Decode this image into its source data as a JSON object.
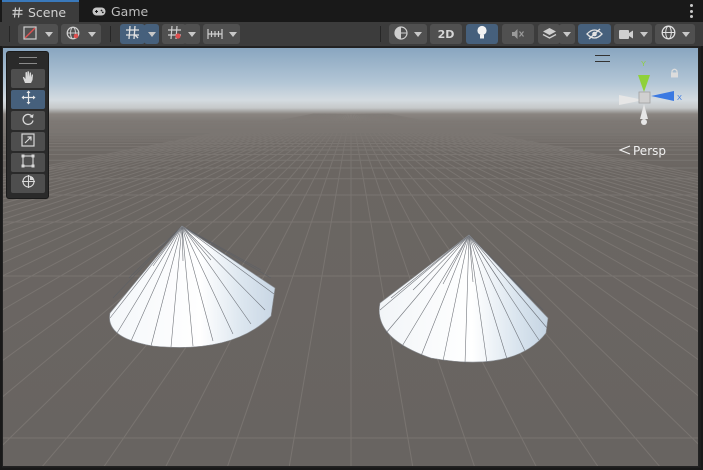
{
  "tabs": [
    {
      "label": "Scene",
      "icon": "hash-icon",
      "active": true
    },
    {
      "label": "Game",
      "icon": "gamepad-icon",
      "active": false
    }
  ],
  "toolbar": {
    "toggle_2d_label": "2D"
  },
  "tools": [
    {
      "name": "hand-tool",
      "icon": "hand-icon",
      "selected": false
    },
    {
      "name": "move-tool",
      "icon": "move-icon",
      "selected": true
    },
    {
      "name": "rotate-tool",
      "icon": "rotate-icon",
      "selected": false
    },
    {
      "name": "scale-tool",
      "icon": "scale-icon",
      "selected": false
    },
    {
      "name": "rect-tool",
      "icon": "rect-icon",
      "selected": false
    },
    {
      "name": "transform-tool",
      "icon": "transform-icon",
      "selected": false
    }
  ],
  "gizmo": {
    "y_label": "Y",
    "x_label": "X",
    "projection_label": "Persp"
  },
  "colors": {
    "accent": "#46607c",
    "tab_highlight": "#3a79bb",
    "axis_x": "#e23b3b",
    "axis_y": "#8fd13b",
    "axis_z": "#3a79e2",
    "ground": "#6b6662",
    "sky": "#89a6c0"
  },
  "scene_objects": [
    {
      "type": "cone",
      "name": "cone-left"
    },
    {
      "type": "cone",
      "name": "cone-right"
    }
  ]
}
